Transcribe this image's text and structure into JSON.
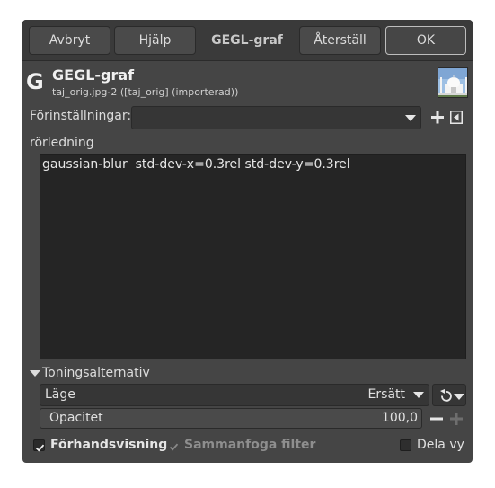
{
  "headerbar": {
    "cancel_label": "Avbryt",
    "help_label": "Hjälp",
    "title": "GEGL-graf",
    "reset_label": "Återställ",
    "ok_label": "OK"
  },
  "plugin": {
    "icon_letter": "G",
    "title": "GEGL-graf",
    "subtitle": "taj_orig.jpg-2 ([taj_orig] (importerad))"
  },
  "presets": {
    "label": "Förinställningar:",
    "value": ""
  },
  "pipeline": {
    "label": "rörledning",
    "text": "gaussian-blur  std-dev-x=0.3rel std-dev-y=0.3rel"
  },
  "blending": {
    "header": "Toningsalternativ",
    "mode_label": "Läge",
    "mode_value": "Ersätt",
    "opacity_label": "Opacitet",
    "opacity_value": "100,0"
  },
  "footer": {
    "preview_label": "Förhandsvisning",
    "preview_checked": true,
    "merge_label": "Sammanfoga filter",
    "merge_checked": true,
    "split_label": "Dela vy",
    "split_checked": false
  },
  "colors": {
    "dialog_bg": "#454545",
    "text_area_bg": "#252525",
    "accent_border": "#bdbdbd"
  }
}
